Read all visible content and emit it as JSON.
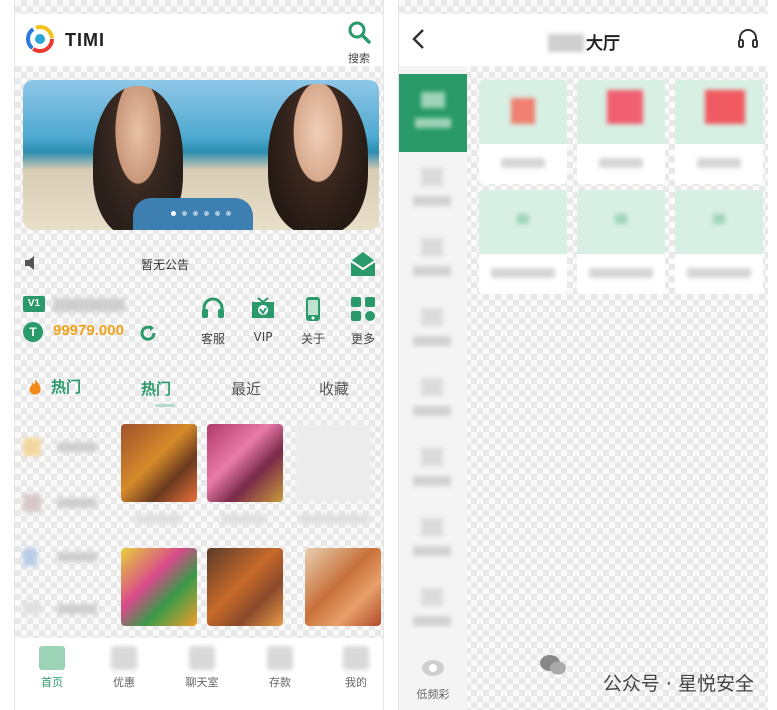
{
  "left": {
    "header": {
      "app_name": "TIMI",
      "search_label": "搜索"
    },
    "notice": {
      "text": "暂无公告"
    },
    "account": {
      "level": "V1",
      "balance": "99979.000"
    },
    "quick_actions": [
      {
        "label": "客服",
        "icon": "headset-icon"
      },
      {
        "label": "VIP",
        "icon": "vip-shield-icon"
      },
      {
        "label": "关于",
        "icon": "phone-icon"
      },
      {
        "label": "更多",
        "icon": "grid-more-icon"
      }
    ],
    "side_category_label": "热门",
    "tabs": [
      "热门",
      "最近",
      "收藏"
    ],
    "bottom_nav": [
      {
        "label": "首页",
        "active": true
      },
      {
        "label": "优惠",
        "active": false
      },
      {
        "label": "聊天室",
        "active": false
      },
      {
        "label": "存款",
        "active": false
      },
      {
        "label": "我的",
        "active": false
      }
    ]
  },
  "right": {
    "title_suffix": "大厅",
    "sidebar_bottom_label": "低频彩"
  },
  "watermark": {
    "text": "公众号 · 星悦安全"
  },
  "colors": {
    "accent": "#2a9a6a",
    "balance": "#f0a31a",
    "banner_sea": "#2c8db0"
  }
}
